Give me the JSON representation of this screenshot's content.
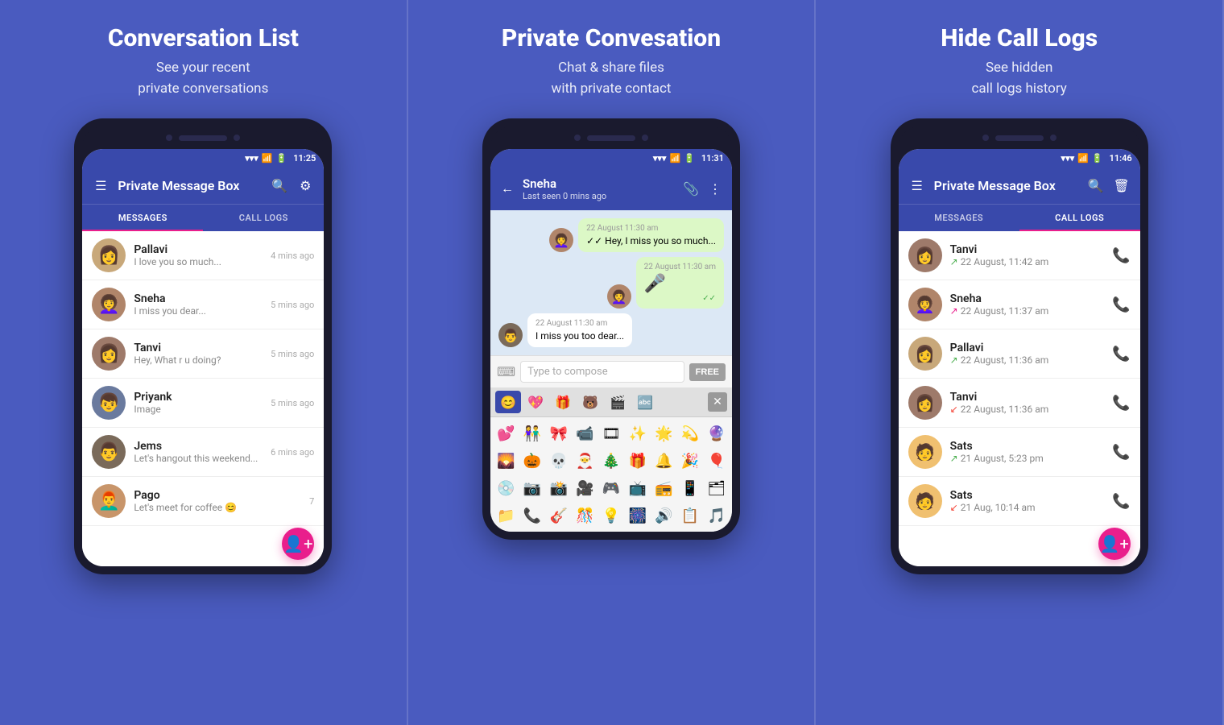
{
  "panels": [
    {
      "id": "conversation-list",
      "title": "Conversation List",
      "subtitle": "See your recent\nprivate conversations",
      "phone": {
        "time": "11:25",
        "header_title": "Private Message Box",
        "tabs": [
          "MESSAGES",
          "CALL LOGS"
        ],
        "active_tab": 0,
        "conversations": [
          {
            "name": "Pallavi",
            "preview": "I love you so much...",
            "time": "4 mins ago",
            "avatar": "👩"
          },
          {
            "name": "Sneha",
            "preview": "I miss you dear...",
            "time": "5 mins ago",
            "avatar": "👩‍🦱"
          },
          {
            "name": "Tanvi",
            "preview": "Hey, What r u doing?",
            "time": "5 mins ago",
            "avatar": "👩"
          },
          {
            "name": "Priyank",
            "preview": "Image",
            "time": "5 mins ago",
            "avatar": "👦"
          },
          {
            "name": "Jems",
            "preview": "Let's hangout this weekend...",
            "time": "6 mins ago",
            "avatar": "👨"
          },
          {
            "name": "Pago",
            "preview": "Let's meet for coffee 😊",
            "time": "7",
            "avatar": "👨‍🦰"
          }
        ],
        "fab_label": "+"
      }
    },
    {
      "id": "private-conversation",
      "title": "Private Convesation",
      "subtitle": "Chat & share files\nwith private contact",
      "phone": {
        "time": "11:31",
        "contact_name": "Sneha",
        "contact_status": "Last seen 0 mins ago",
        "messages": [
          {
            "type": "out",
            "timestamp": "22 August 11:30 am",
            "text": "Hey, I miss you so much...",
            "avatar": "👩‍🦱"
          },
          {
            "type": "out",
            "timestamp": "22 August 11:30 am",
            "text": "🎤",
            "avatar": "👩‍🦱"
          },
          {
            "type": "in",
            "timestamp": "22 August 11:30 am",
            "text": "I miss you too dear...",
            "avatar": "👨"
          }
        ],
        "compose_placeholder": "Type to compose",
        "compose_btn": "FREE",
        "emoji_tabs": [
          "😊",
          "💖",
          "🎁",
          "🐻",
          "🎬",
          "🔤"
        ],
        "emojis": [
          "💕",
          "👫",
          "🎀",
          "📹",
          "🎞",
          "✨",
          "🌟",
          "💫",
          "🔮",
          "🌄",
          "🎃",
          "💀",
          "🎅",
          "🎄",
          "🎁",
          "🔔",
          "🎉",
          "🎈",
          "💿",
          "📷",
          "📸",
          "🎥",
          "🎮",
          "📺",
          "📻",
          "📱",
          "🗂",
          "📁",
          "📞",
          "🎸",
          "🎊",
          "💡",
          "🎆",
          "🔊",
          "📋",
          "🎵"
        ]
      }
    },
    {
      "id": "hide-call-logs",
      "title": "Hide Call Logs",
      "subtitle": "See hidden\ncall logs history",
      "phone": {
        "time": "11:46",
        "header_title": "Private Message Box",
        "tabs": [
          "MESSAGES",
          "CALL LOGS"
        ],
        "active_tab": 1,
        "calls": [
          {
            "name": "Tanvi",
            "time": "22 August, 11:42 am",
            "type": "out"
          },
          {
            "name": "Sneha",
            "time": "22 August, 11:37 am",
            "type": "in"
          },
          {
            "name": "Pallavi",
            "time": "22 August, 11:36 am",
            "type": "out"
          },
          {
            "name": "Tanvi",
            "time": "22 August, 11:36 am",
            "type": "miss"
          },
          {
            "name": "Sats",
            "time": "21 August, 5:23 pm",
            "type": "out"
          },
          {
            "name": "Sats",
            "time": "21 Aug, 10:14 am",
            "type": "miss"
          }
        ],
        "fab_label": "+"
      }
    }
  ]
}
